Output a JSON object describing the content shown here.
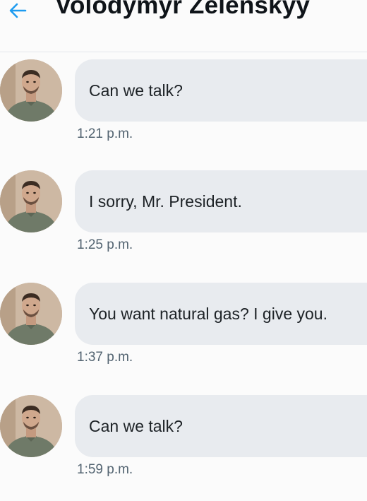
{
  "header": {
    "title": "Volodymyr Zelenskyy",
    "back_icon": "arrow-left-icon",
    "accent_color": "#1d9bf0"
  },
  "messages": [
    {
      "text": "Can we talk?",
      "time": "1:21 p.m."
    },
    {
      "text": "I sorry, Mr. President.",
      "time": "1:25 p.m."
    },
    {
      "text": "You want natural gas? I give you.",
      "time": "1:37 p.m."
    },
    {
      "text": "Can we talk?",
      "time": "1:59 p.m."
    }
  ],
  "colors": {
    "bubble": "#e8ebef",
    "background": "#fbfbfb",
    "timestamp": "#536471"
  }
}
